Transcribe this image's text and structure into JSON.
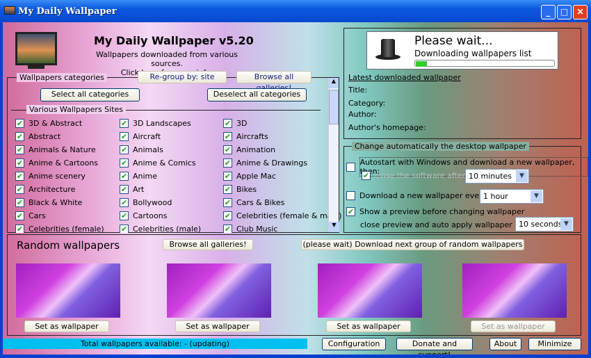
{
  "window": {
    "title": "My Daily Wallpaper"
  },
  "header": {
    "title": "My Daily Wallpaper v5.20",
    "subtitle": "Wallpapers downloaded from various sources.",
    "info_link": "Click here for more info."
  },
  "categories": {
    "group_label": "Wallpapers categories",
    "regroup": "Re-group by: site",
    "browse_all": "Browse all galleries!",
    "select_all": "Select all categories",
    "deselect_all": "Deselect all categories",
    "section_label": "Various Wallpapers Sites",
    "items": [
      {
        "label": "3D & Abstract",
        "checked": true
      },
      {
        "label": "3D Landscapes",
        "checked": true
      },
      {
        "label": "3D",
        "checked": true
      },
      {
        "label": "Abstract",
        "checked": true
      },
      {
        "label": "Aircraft",
        "checked": true
      },
      {
        "label": "Aircrafts",
        "checked": true
      },
      {
        "label": "Animals & Nature",
        "checked": true
      },
      {
        "label": "Animals",
        "checked": true
      },
      {
        "label": "Animation",
        "checked": true
      },
      {
        "label": "Anime & Cartoons",
        "checked": true
      },
      {
        "label": "Anime & Comics",
        "checked": true
      },
      {
        "label": "Anime & Drawings",
        "checked": true
      },
      {
        "label": "Anime scenery",
        "checked": true
      },
      {
        "label": "Anime",
        "checked": true
      },
      {
        "label": "Apple Mac",
        "checked": true
      },
      {
        "label": "Architecture",
        "checked": true
      },
      {
        "label": "Art",
        "checked": true
      },
      {
        "label": "Bikes",
        "checked": true
      },
      {
        "label": "Black & White",
        "checked": true
      },
      {
        "label": "Bollywood",
        "checked": true
      },
      {
        "label": "Cars & Bikes",
        "checked": true
      },
      {
        "label": "Cars",
        "checked": true
      },
      {
        "label": "Cartoons",
        "checked": true
      },
      {
        "label": "Celebrities (female & male)",
        "checked": true
      },
      {
        "label": "Celebrities (female)",
        "checked": true
      },
      {
        "label": "Celebrities (male)",
        "checked": true
      },
      {
        "label": "Club Music",
        "checked": true
      }
    ]
  },
  "status_box": {
    "title": "Please wait...",
    "message": "Downloading wallpapers list",
    "progress": 0.08
  },
  "latest": {
    "heading": "Latest downloaded wallpaper",
    "title": "Title:",
    "category": "Category:",
    "author": "Author:",
    "homepage": "Author's homepage:"
  },
  "auto": {
    "group_label": "Change automatically the desktop wallpaper",
    "autostart": "Autostart with Windows and download a new wallpaper, then:",
    "close_after": "close the software after",
    "close_after_value": "10 minutes",
    "download_every": "Download a new wallpaper every",
    "download_every_value": "1 hour",
    "show_preview": "Show a preview before changing wallpaper",
    "auto_apply": "close preview and auto apply wallpaper after",
    "auto_apply_value": "10 seconds"
  },
  "random": {
    "title": "Random wallpapers",
    "browse_all": "Browse all galleries!",
    "download_next": "(please wait) Download next group of random wallpapers",
    "set_label": "Set as wallpaper"
  },
  "footer": {
    "status": "Total wallpapers available: - (updating)",
    "configuration": "Configuration",
    "donate": "Donate and support!",
    "about": "About",
    "minimize": "Minimize"
  },
  "colors": {
    "status_bar": "#00c0f0",
    "titlebar": "#0a5ae0"
  }
}
